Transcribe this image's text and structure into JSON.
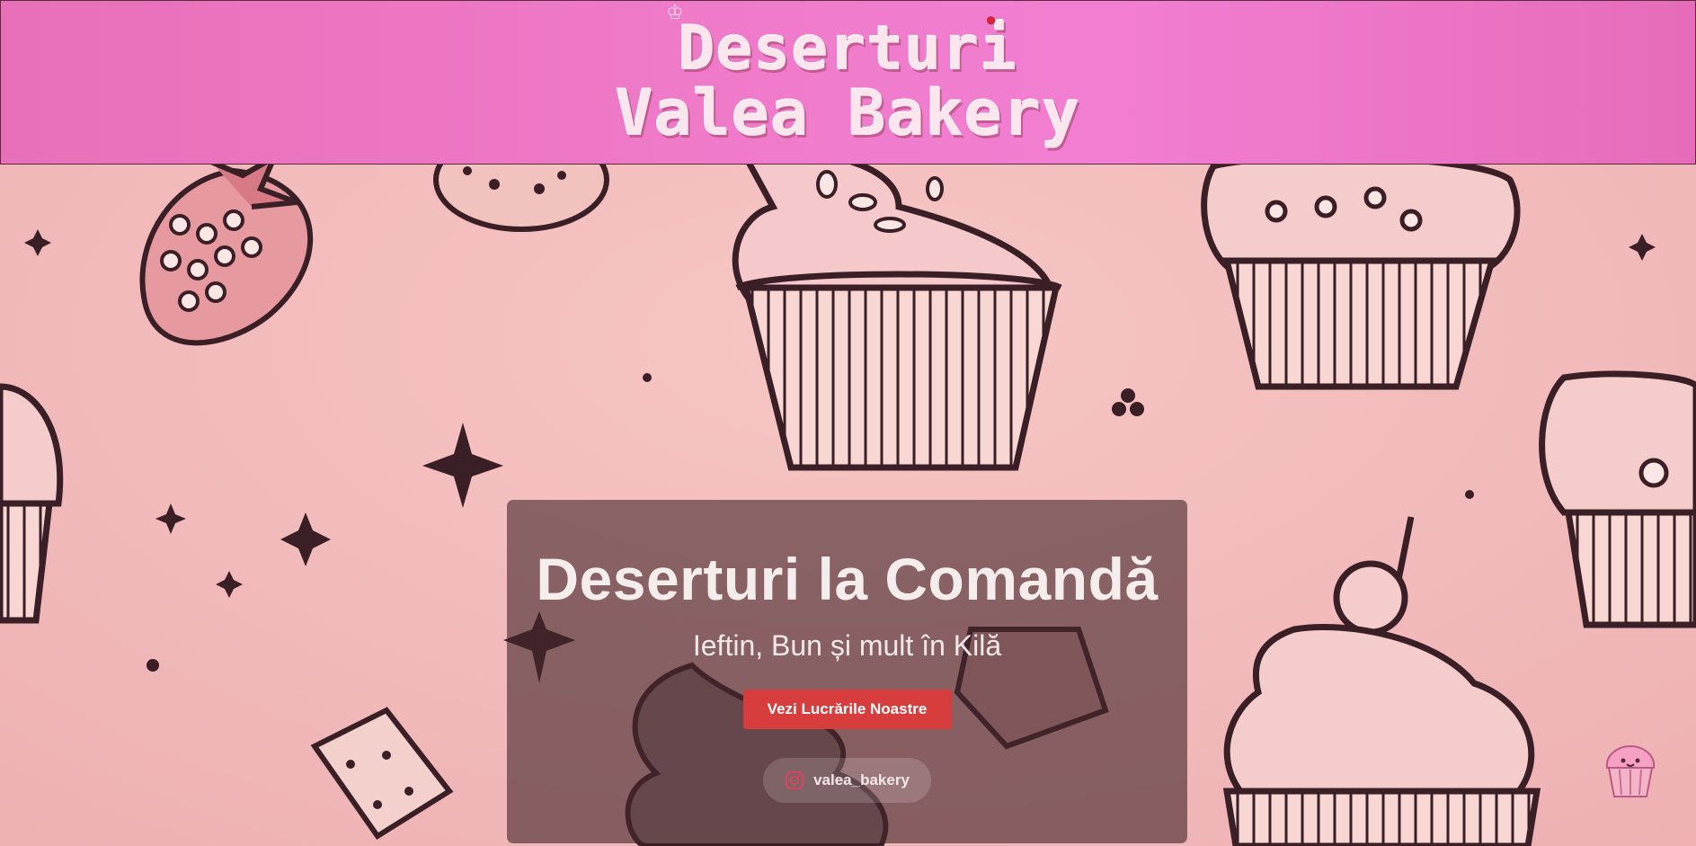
{
  "header": {
    "logo_line1": "Deserturi",
    "logo_line2": "Valea Bakery"
  },
  "hero": {
    "title": "Deserturi la Comandă",
    "subtitle": "Ieftin, Bun și mult în Kilă",
    "cta_label": "Vezi Lucrările Noastre",
    "instagram_handle": "valea_bakery"
  },
  "icons": {
    "instagram": "instagram-icon",
    "floating_badge": "cupcake-icon"
  },
  "colors": {
    "header_pink": "#f07ccc",
    "background_pink": "#f2b9b9",
    "cta_red": "#d83d3d",
    "card_overlay": "rgba(70,40,45,0.62)",
    "outline": "#3a1f26"
  }
}
